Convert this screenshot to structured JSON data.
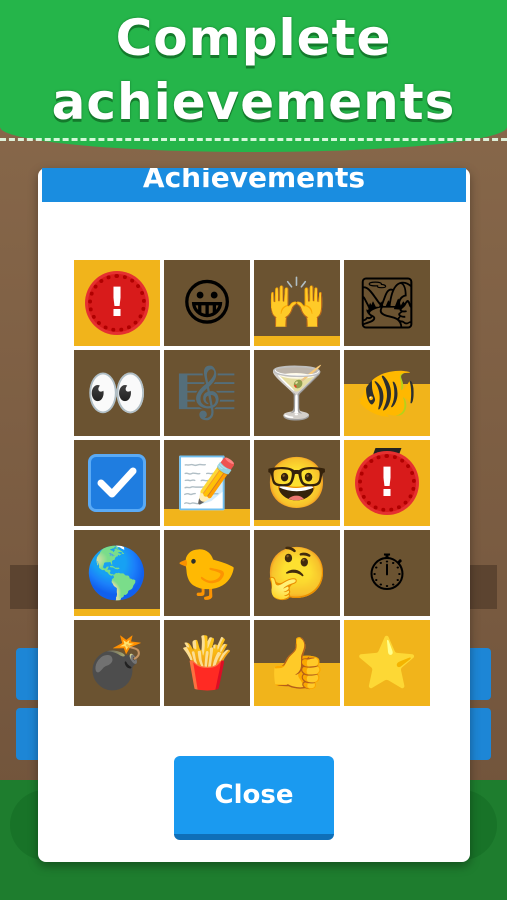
{
  "banner": {
    "line1": "Complete",
    "line2": "achievements"
  },
  "dialog": {
    "title": "Achievements",
    "close_label": "Close"
  },
  "achievements": [
    {
      "icon": "exclamation-badge-icon",
      "glyph": "!",
      "progress": 1.0
    },
    {
      "icon": "grinning-face-icon",
      "glyph": "😀",
      "progress": 0.0
    },
    {
      "icon": "raised-hands-icon",
      "glyph": "🙌",
      "progress": 0.12
    },
    {
      "icon": "national-park-icon",
      "glyph": "🏞",
      "progress": 0.0
    },
    {
      "icon": "eyes-icon",
      "glyph": "👀",
      "progress": 0.0
    },
    {
      "icon": "music-notes-icon",
      "glyph": "🎼",
      "progress": 0.0
    },
    {
      "icon": "cocktail-icon",
      "glyph": "🍸",
      "progress": 0.0
    },
    {
      "icon": "tropical-fish-icon",
      "glyph": "🐠",
      "progress": 0.6
    },
    {
      "icon": "check-box-icon",
      "glyph": "✔",
      "progress": 0.0
    },
    {
      "icon": "memo-icon",
      "glyph": "📝",
      "progress": 0.2
    },
    {
      "icon": "nerd-face-icon",
      "glyph": "🤓",
      "progress": 0.07
    },
    {
      "icon": "exclamation-grad-badge-icon",
      "glyph": "!",
      "progress": 1.0
    },
    {
      "icon": "globe-americas-icon",
      "glyph": "🌎",
      "progress": 0.08
    },
    {
      "icon": "baby-chick-icon",
      "glyph": "🐤",
      "progress": 0.0
    },
    {
      "icon": "thinking-face-icon",
      "glyph": "🤔",
      "progress": 0.0
    },
    {
      "icon": "stopwatch-icon",
      "glyph": "⏱",
      "progress": 0.0
    },
    {
      "icon": "bomb-icon",
      "glyph": "💣",
      "progress": 0.0
    },
    {
      "icon": "french-fries-icon",
      "glyph": "🍟",
      "progress": 0.0
    },
    {
      "icon": "thumbs-up-icon",
      "glyph": "👍",
      "progress": 0.5
    },
    {
      "icon": "star-icon",
      "glyph": "⭐",
      "progress": 1.0
    }
  ],
  "colors": {
    "banner_green": "#25b54a",
    "dialog_header_blue": "#1a8de0",
    "cell_brown": "#6b5331",
    "progress_yellow": "#f1b41b",
    "close_button_blue": "#1a9af0"
  }
}
